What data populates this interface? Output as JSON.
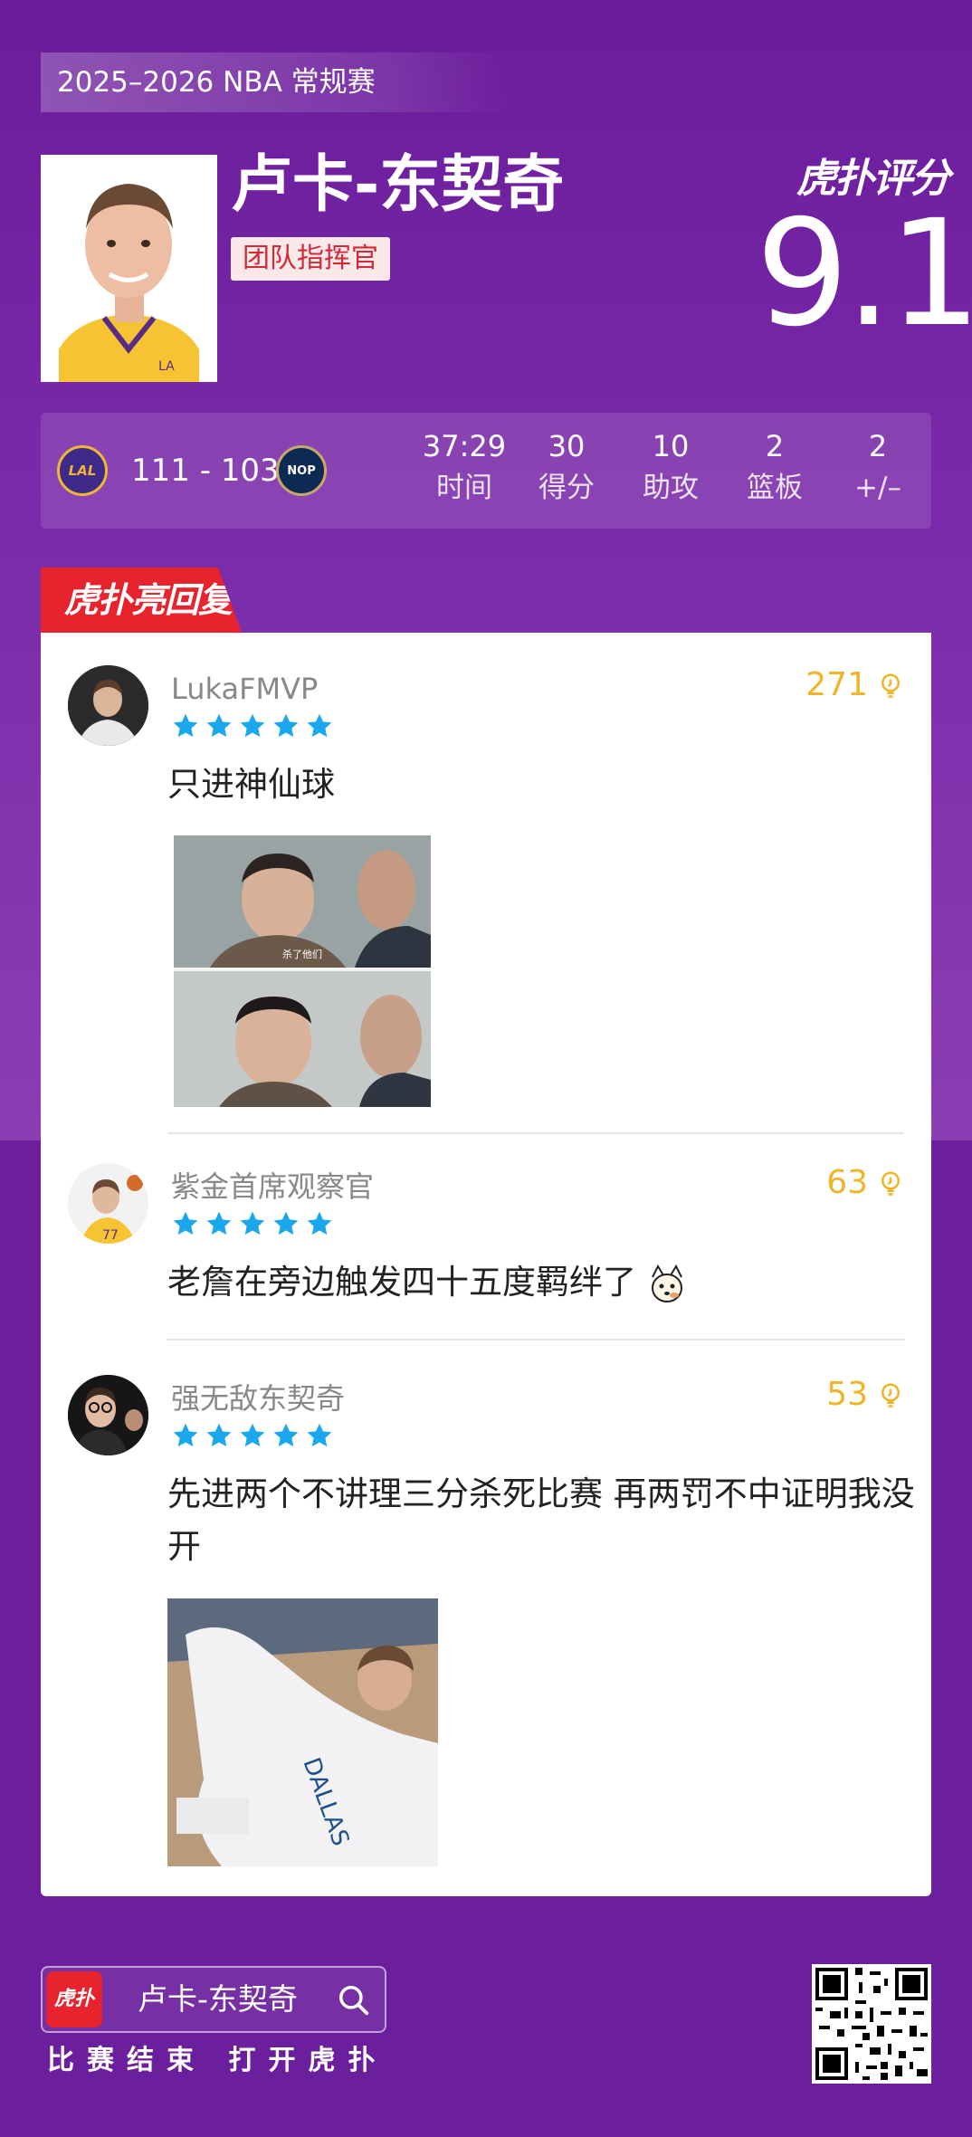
{
  "season": "2025–2026 NBA 常规赛",
  "player": {
    "name": "卢卡-东契奇",
    "badge": "团队指挥官"
  },
  "rating": {
    "brand": "虎扑评分",
    "score": "9.1"
  },
  "game": {
    "home_team": "LAL",
    "away_team": "NOP",
    "score": "111 - 103"
  },
  "stats": [
    {
      "value": "37:29",
      "label": "时间"
    },
    {
      "value": "30",
      "label": "得分"
    },
    {
      "value": "10",
      "label": "助攻"
    },
    {
      "value": "2",
      "label": "篮板"
    },
    {
      "value": "2",
      "label": "+/–"
    }
  ],
  "highlight_tab": "虎扑亮回复",
  "comments": [
    {
      "username": "LukaFMVP",
      "stars": 5,
      "likes": "271",
      "text": "只进神仙球",
      "meme_caption": "杀了他们"
    },
    {
      "username": "紫金首席观察官",
      "stars": 5,
      "likes": "63",
      "text": "老詹在旁边触发四十五度羁绊了"
    },
    {
      "username": "强无敌东契奇",
      "stars": 5,
      "likes": "53",
      "text": "先进两个不讲理三分杀死比赛 再两罚不中证明我没开",
      "meme_caption": "DALLAS"
    }
  ],
  "footer": {
    "app_logo": "虎扑",
    "search_name": "卢卡-东契奇",
    "cta": "比赛结束 打开虎扑"
  },
  "colors": {
    "background": "#6a1f9c",
    "accent_red": "#e7232e",
    "star_blue": "#1aa7ec",
    "like_gold": "#f0b429"
  }
}
